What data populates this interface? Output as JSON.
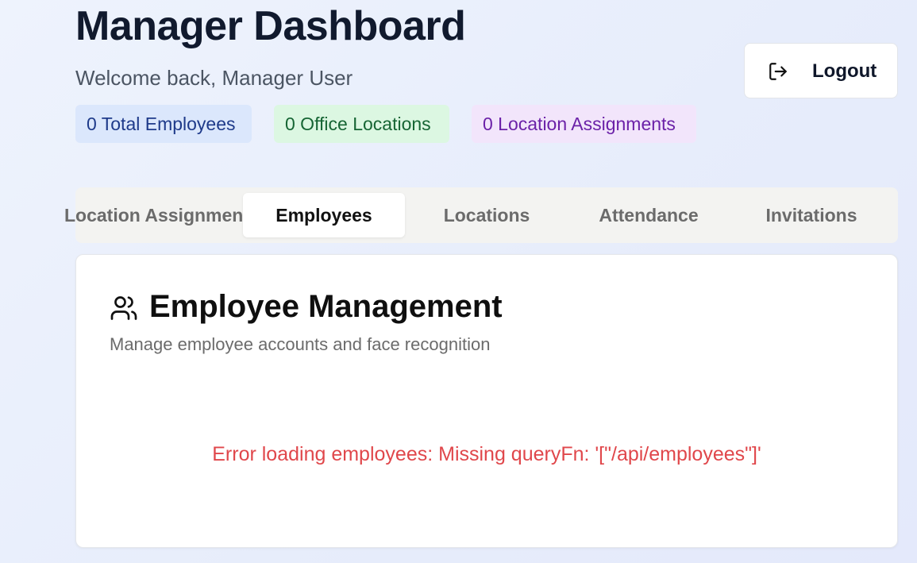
{
  "header": {
    "title": "Manager Dashboard",
    "welcome": "Welcome back, Manager User",
    "logout_label": "Logout"
  },
  "stats": {
    "employees": "0 Total Employees",
    "offices": "0 Office Locations",
    "assignments": "0 Location Assignments"
  },
  "tabs": [
    {
      "label": "Location Assignments",
      "active": false
    },
    {
      "label": "Employees",
      "active": true
    },
    {
      "label": "Locations",
      "active": false
    },
    {
      "label": "Attendance",
      "active": false
    },
    {
      "label": "Invitations",
      "active": false
    }
  ],
  "card": {
    "icon": "users-icon",
    "title": "Employee Management",
    "subtitle": "Manage employee accounts and face recognition",
    "error": "Error loading employees: Missing queryFn: '[\"/api/employees\"]'"
  },
  "colors": {
    "error": "#e0474b",
    "employees_badge_bg": "#dbe7fc",
    "offices_badge_bg": "#dcf7e2",
    "assignments_badge_bg": "#f2e5fb"
  }
}
